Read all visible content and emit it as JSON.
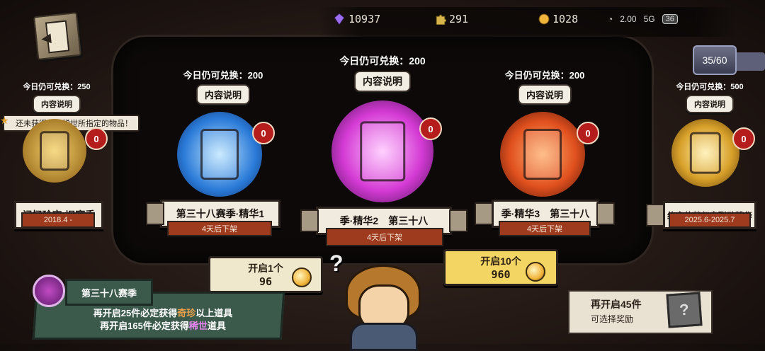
{
  "top_bar": {
    "resources": [
      {
        "icon": "purple-crystal-icon",
        "value": "10937",
        "color": "#9a6cf0"
      },
      {
        "icon": "puzzle-piece-icon",
        "value": "291",
        "color": "#d7b44a"
      },
      {
        "icon": "gold-coin-icon",
        "value": "1028",
        "color": "#f0b43a"
      }
    ],
    "status_text": "2.00",
    "network": "5G",
    "battery": "36"
  },
  "counter": "35/60",
  "tooltip": "还未获得首次稀世所指定的物品！",
  "cards": [
    {
      "redeem": "今日仍可兑换：250",
      "info": "内容说明",
      "count": "0",
      "title": "记忆珍宝·旧赛季",
      "sub": "2018.4 -",
      "color": "#e0a830"
    },
    {
      "redeem": "今日仍可兑换：200",
      "info": "内容说明",
      "count": "0",
      "title": "第三十八赛季·精华1",
      "sub": "4天后下架",
      "color": "#3fa0f0"
    },
    {
      "redeem": "今日仍可兑换：200",
      "info": "内容说明",
      "count": "0",
      "title": "季·精华2　第三十八",
      "sub": "4天后下架",
      "color": "#d84ad8"
    },
    {
      "redeem": "今日仍可兑换：200",
      "info": "内容说明",
      "count": "0",
      "title": "季·精华3　第三十八",
      "sub": "4天后下架",
      "color": "#e8602a"
    },
    {
      "redeem": "今日仍可兑换：500",
      "info": "内容说明",
      "count": "0",
      "title": "约定的梦幻岛联动精华",
      "sub": "2025.6-2025.7",
      "color": "#e6b83a"
    }
  ],
  "open_one": {
    "label": "开启1个",
    "cost": "96"
  },
  "open_ten": {
    "label": "开启10个",
    "cost": "960"
  },
  "season": {
    "title": "第三十八赛季",
    "line1_a": "再开启25件必定获得",
    "line1_hl": "奇珍",
    "line1_b": "以上道具",
    "line2_a": "再开启165件必定获得",
    "line2_hl": "稀世",
    "line2_b": "道具"
  },
  "reward": {
    "line1": "再开启45件",
    "line2": "可选择奖励",
    "box_symbol": "?"
  }
}
